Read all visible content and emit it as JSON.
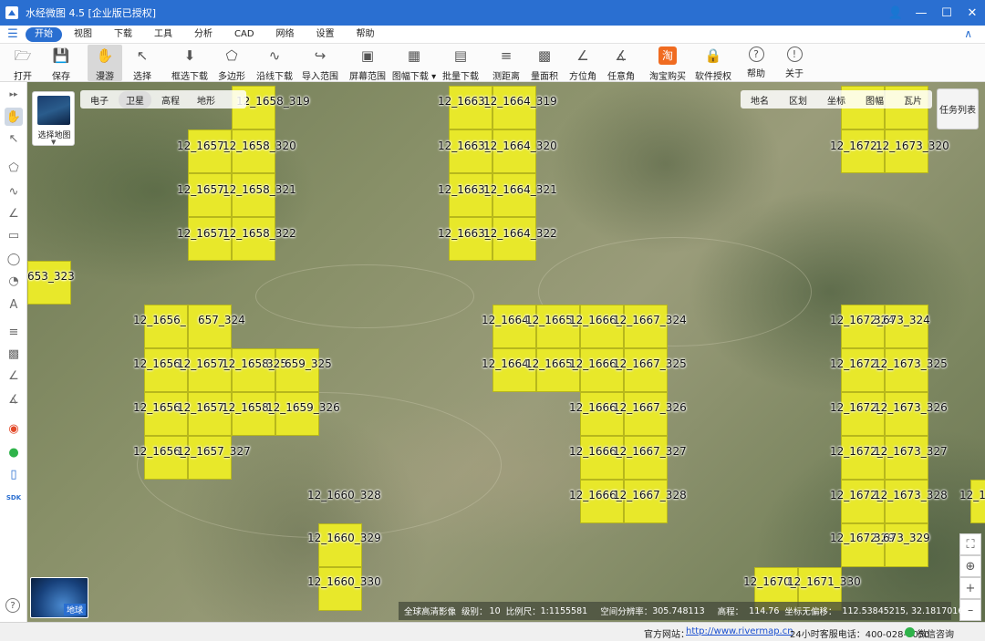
{
  "window": {
    "title": "水经微图 4.5 [企业版已授权]",
    "controls": [
      "user-icon",
      "minimize-icon",
      "maximize-icon",
      "close-icon"
    ]
  },
  "menu": {
    "tabs": [
      "开始",
      "视图",
      "下载",
      "工具",
      "分析",
      "CAD",
      "网络",
      "设置",
      "帮助"
    ],
    "active": "开始"
  },
  "ribbon": {
    "buttons": [
      {
        "label": "打开",
        "icon": "folder-icon"
      },
      {
        "label": "保存",
        "icon": "save-icon"
      },
      {
        "label": "漫游",
        "icon": "hand-icon"
      },
      {
        "label": "选择",
        "icon": "cursor-icon"
      },
      {
        "label": "框选下载",
        "icon": "rect-download-icon"
      },
      {
        "label": "多边形",
        "icon": "polygon-icon"
      },
      {
        "label": "沿线下载",
        "icon": "line-download-icon"
      },
      {
        "label": "导入范围",
        "icon": "import-range-icon"
      },
      {
        "label": "屏幕范围",
        "icon": "screen-range-icon"
      },
      {
        "label": "图幅下载",
        "icon": "sheet-download-icon"
      },
      {
        "label": "批量下载",
        "icon": "batch-download-icon"
      },
      {
        "label": "测距离",
        "icon": "measure-distance-icon"
      },
      {
        "label": "量面积",
        "icon": "measure-area-icon"
      },
      {
        "label": "方位角",
        "icon": "azimuth-icon"
      },
      {
        "label": "任意角",
        "icon": "angle-icon"
      },
      {
        "label": "淘宝购买",
        "icon": "taobao-icon"
      },
      {
        "label": "软件授权",
        "icon": "lock-icon"
      },
      {
        "label": "帮助",
        "icon": "help-icon"
      },
      {
        "label": "关于",
        "icon": "info-icon"
      }
    ]
  },
  "map_controls": {
    "select_map_label": "选择地图",
    "layers": [
      "电子",
      "卫星",
      "高程",
      "地形"
    ],
    "active_layer": "卫星",
    "overlays": [
      "地名",
      "区划",
      "坐标",
      "图幅",
      "瓦片"
    ],
    "task_list": "任务列表",
    "globe_label": "地球"
  },
  "tiles": {
    "labels": [
      "12_1658_319",
      "12_1657_",
      "12_1658_320",
      "12_1657_",
      "12_1658_321",
      "12_1657_",
      "12_1658_322",
      "12_1663_",
      "12_1664_319",
      "12_1663_",
      "12_1664_320",
      "12_1663_",
      "12_1664_321",
      "12_1663_",
      "12_1664_322",
      "12_1672_",
      "12_1673_320",
      "653_323",
      "12_1656_",
      "657_324",
      "12_1656_",
      "12_1657_",
      "12_1658_",
      "325",
      "659_325",
      "12_1656_",
      "12_1657_",
      "12_1658_",
      "12_1659_326",
      "12_1656_",
      "12_1657_327",
      "12_1664_",
      "12_1665_",
      "12_1666_",
      "12_1667_324",
      "12_1664_",
      "12_1665_",
      "12_1666_",
      "12_1667_325",
      "12_1666_",
      "12_1667_326",
      "12_1666_",
      "12_1667_327",
      "12_1666_",
      "12_1667_328",
      "12_1672_",
      "324",
      "673_324",
      "12_1672_",
      "12_1673_325",
      "12_1672_",
      "12_1673_326",
      "12_1672_",
      "12_1673_327",
      "12_1672_",
      "12_1673_328",
      "12_1672_",
      "329",
      "673_329",
      "12_1660_328",
      "12_1660_329",
      "12_1660_330",
      "12_1670_",
      "12_1671_330",
      "12_1"
    ]
  },
  "info_bar": {
    "imagery": "全球高清影像",
    "level_label": "级别：",
    "level": "10",
    "scale_label": "比例尺：",
    "scale": "1:1155581",
    "resolution_label": "空间分辨率：",
    "resolution": "305.748113",
    "elevation_label": "高程：",
    "elevation": "114.76",
    "coord_label": "坐标无偏移：",
    "coords": "112.53845215, 32.18170166"
  },
  "status_bar": {
    "site_label": "官方网站：",
    "site_url": "http://www.rivermap.cn",
    "phone": "24小时客服电话：400-028-0050",
    "chat": "微信咨询"
  }
}
